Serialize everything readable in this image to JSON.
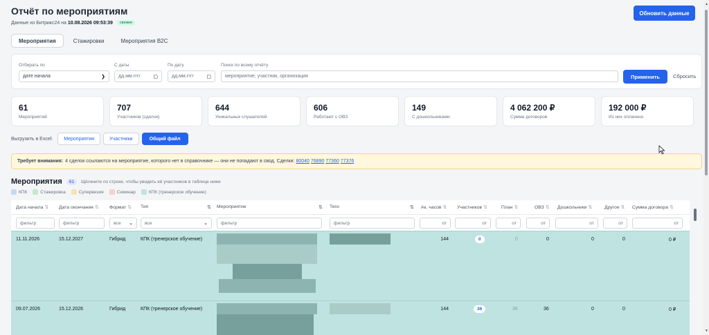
{
  "header": {
    "title": "Отчёт по мероприятиям",
    "subtitle_prefix": "Данные из Битрикс24 на",
    "timestamp": "10.08.2026 09:53:39",
    "fresh_badge": "свежие",
    "refresh_label": "Обновить данные"
  },
  "tabs": [
    {
      "label": "Мероприятия",
      "active": true
    },
    {
      "label": "Стажировки",
      "active": false
    },
    {
      "label": "Мероприятия B2C",
      "active": false
    }
  ],
  "filters": {
    "sort_label": "Отбирать по",
    "sort_value": "дате начала",
    "from_label": "С даты",
    "from_placeholder": "дд.мм.гггг",
    "to_label": "По дату",
    "to_placeholder": "дд.мм.гггг",
    "search_label": "Поиск по всему отчёту",
    "search_placeholder": "мероприятие, участник, организация",
    "apply_label": "Применить",
    "reset_label": "Сбросить"
  },
  "stats": [
    {
      "value": "61",
      "label": "Мероприятий"
    },
    {
      "value": "707",
      "label": "Участников (сделок)"
    },
    {
      "value": "644",
      "label": "Уникальных слушателей"
    },
    {
      "value": "606",
      "label": "Работают с ОВЗ"
    },
    {
      "value": "149",
      "label": "С дошкольниками"
    },
    {
      "value": "4 062 200 ₽",
      "label": "Сумма договоров"
    },
    {
      "value": "192 000 ₽",
      "label": "Из них оплачено"
    }
  ],
  "export": {
    "label": "Выгрузить в Excel:",
    "events": "Мероприятия",
    "participants": "Участники",
    "all": "Общий файл"
  },
  "warning": {
    "title": "Требует внимания:",
    "text": "4 сделок ссылаются на мероприятие, которого нет в справочнике — они не попадают в свод. Сделки:",
    "deals": [
      "80040",
      "76890",
      "77360",
      "77376"
    ]
  },
  "section": {
    "title": "Мероприятия",
    "count": "61",
    "hint": "Щёлкните по строке, чтобы увидеть её участников в таблице ниже"
  },
  "legend": [
    {
      "label": "КПК",
      "color": "#c7d7f5"
    },
    {
      "label": "Стажировка",
      "color": "#c5e8cc"
    },
    {
      "label": "Супервизия",
      "color": "#f7e3b5"
    },
    {
      "label": "Семинар",
      "color": "#f6cfd5"
    },
    {
      "label": "КПК (тренерское обучение)",
      "color": "#c2e3e0"
    }
  ],
  "table": {
    "columns": [
      "Дата начала",
      "Дата окончания",
      "Формат",
      "Тип",
      "Мероприятие",
      "Теги",
      "Ак. часов",
      "Участников",
      "План",
      "ОВЗ",
      "Дошкольники",
      "Другое",
      "Сумма договора"
    ],
    "sort_glyph": "⇅",
    "filters": {
      "text": "фильтр",
      "format": "все",
      "type": "все",
      "min": "от"
    },
    "rows": [
      {
        "start": "11.11.2026",
        "end": "15.12.2027",
        "format": "Гибрид",
        "type": "КПК (тренерское обучение)",
        "hours": "144",
        "participants": "0",
        "plan": "0",
        "ovz": "0",
        "preschool": "0",
        "other": "0",
        "sum": "0 ₽"
      },
      {
        "start": "09.07.2026",
        "end": "15.12.2026",
        "format": "Гибрид",
        "type": "КПК (тренерское обучение)",
        "hours": "144",
        "participants": "36",
        "plan": "36",
        "ovz": "36",
        "preschool": "0",
        "other": "0",
        "sum": "0 ₽"
      }
    ]
  }
}
